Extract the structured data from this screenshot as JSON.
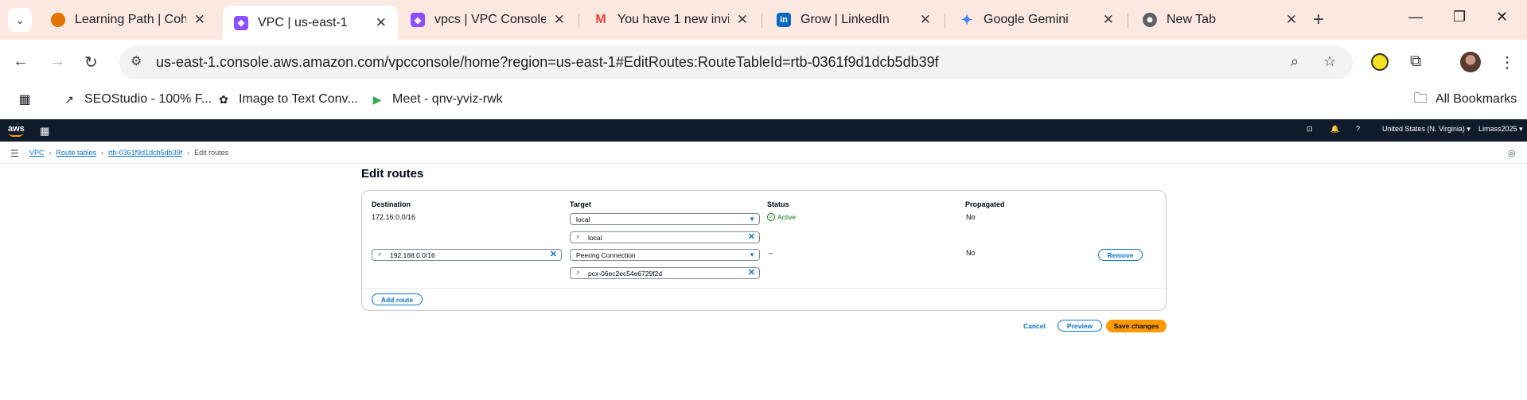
{
  "browser": {
    "tabs": [
      {
        "title": "Learning Path | Coho",
        "favicon_color": "#e37400",
        "icon": "coho-icon"
      },
      {
        "title": "VPC | us-east-1",
        "favicon_color": "#8c4fff",
        "icon": "vpc-icon",
        "active": true
      },
      {
        "title": "vpcs | VPC Console",
        "favicon_color": "#8c4fff",
        "icon": "vpc-icon"
      },
      {
        "title": "You have 1 new invit",
        "favicon_color": "#ea4335",
        "icon": "gmail-icon"
      },
      {
        "title": "Grow | LinkedIn",
        "favicon_color": "#0a66c2",
        "icon": "linkedin-icon"
      },
      {
        "title": "Google Gemini",
        "favicon_color": "#4285f4",
        "icon": "gemini-icon"
      },
      {
        "title": "New Tab",
        "favicon_color": "#5f6368",
        "icon": "chrome-icon"
      }
    ],
    "url_host": "us-east-1.console.aws.amazon.com",
    "url_path": "/vpcconsole/home?region=us-east-1#EditRoutes:RouteTableId=rtb-0361f9d1dcb5db39f",
    "bookmarks": [
      {
        "label": "SEOStudio - 100% F...",
        "icon": "seostudio-icon"
      },
      {
        "label": "Image to Text Conv...",
        "icon": "image-text-icon"
      },
      {
        "label": "Meet - qnv-yviz-rwk",
        "icon": "meet-icon"
      }
    ],
    "all_bookmarks": "All Bookmarks"
  },
  "aws": {
    "logo": "aws",
    "region": "United States (N. Virginia)",
    "account": "Limass2025",
    "breadcrumbs": [
      "VPC",
      "Route tables",
      "rtb-0361f9d1dcb5db39f"
    ],
    "breadcrumb_current": "Edit routes"
  },
  "page": {
    "title": "Edit routes",
    "columns": {
      "destination": "Destination",
      "target": "Target",
      "status": "Status",
      "propagated": "Propagated"
    },
    "routes": [
      {
        "destination": "172.16.0.0/16",
        "target_type": "local",
        "target_value": "local",
        "status": "Active",
        "propagated": "No"
      },
      {
        "destination": "192.168.0.0/16",
        "target_type": "Peering Connection",
        "target_value": "pcx-06ec2ec54e6729f2d",
        "status": "–",
        "propagated": "No",
        "remove_label": "Remove"
      }
    ],
    "add_route_label": "Add route",
    "cancel_label": "Cancel",
    "preview_label": "Preview",
    "save_label": "Save changes"
  }
}
